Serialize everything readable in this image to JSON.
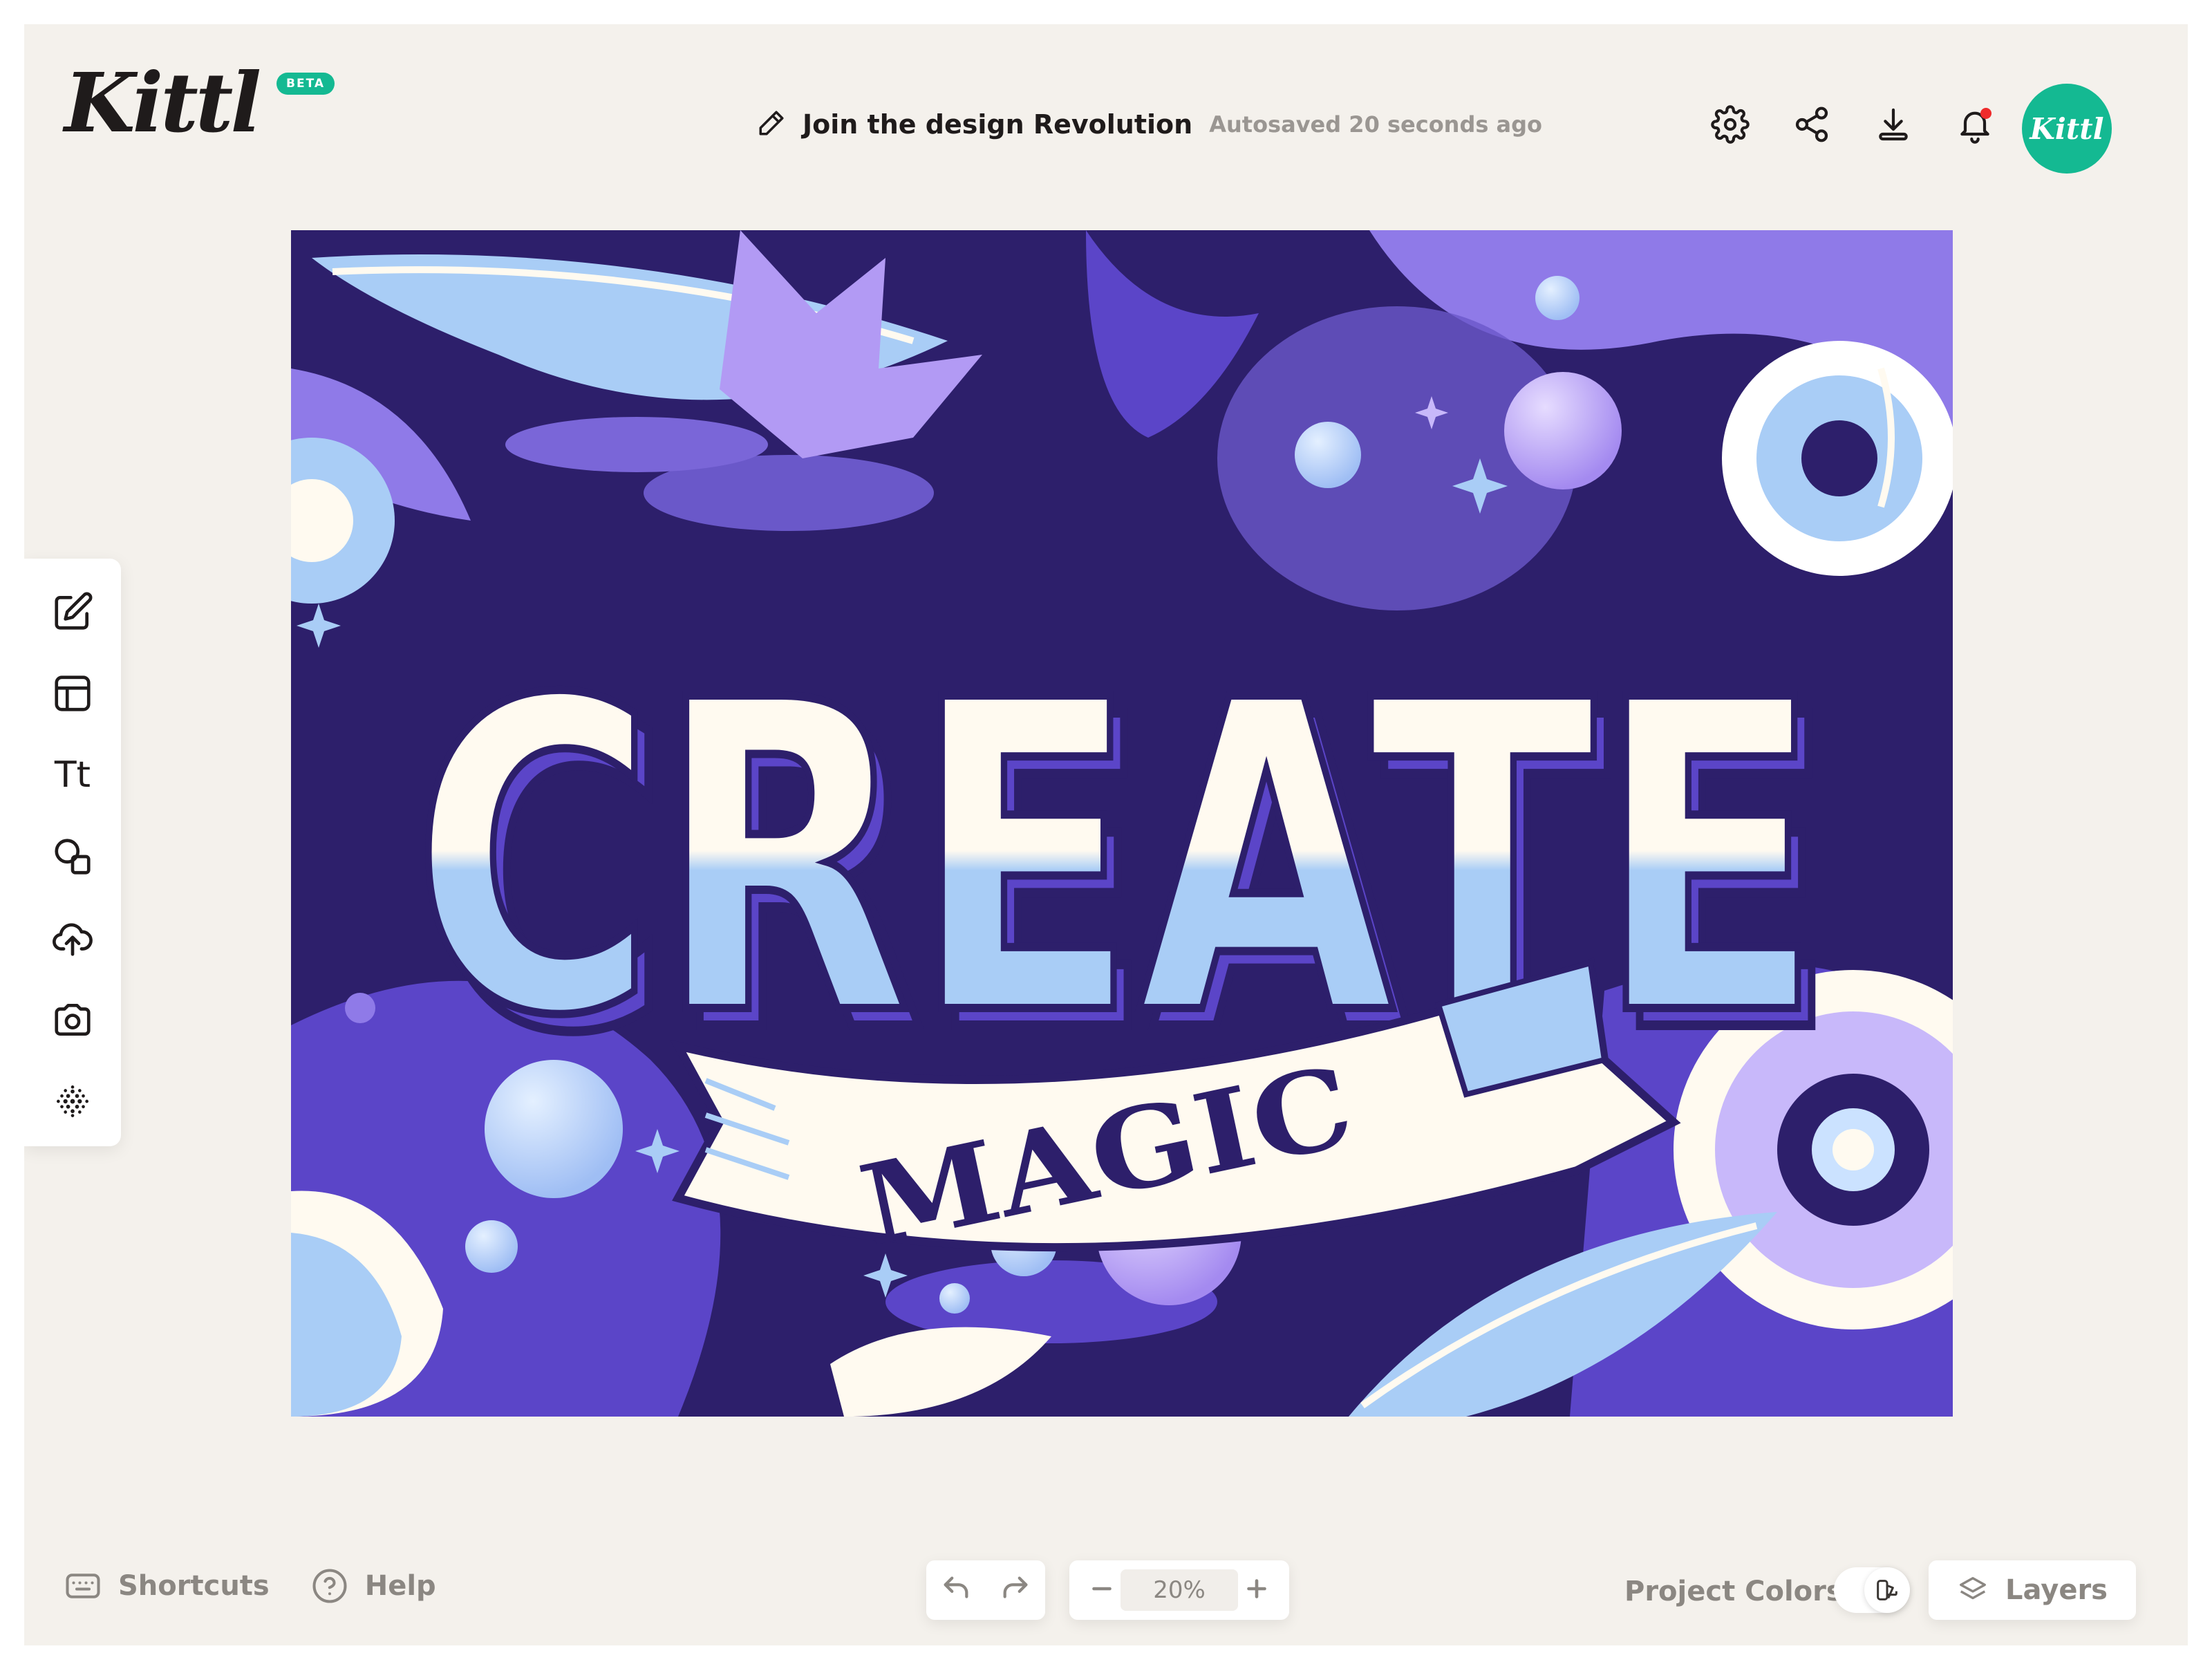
{
  "header": {
    "logo_text": "Kittl",
    "badge": "BETA",
    "project_title": "Join the design Revolution",
    "autosave_status": "Autosaved 20 seconds ago",
    "avatar_text": "Kittl",
    "icons": [
      "gear-icon",
      "share-icon",
      "download-icon",
      "bell-icon"
    ]
  },
  "toolbar": {
    "items": [
      {
        "name": "edit",
        "icon": "edit-icon"
      },
      {
        "name": "templates",
        "icon": "layout-icon"
      },
      {
        "name": "text",
        "icon": "text-icon",
        "label": "Tt"
      },
      {
        "name": "elements",
        "icon": "shapes-icon"
      },
      {
        "name": "uploads",
        "icon": "upload-icon"
      },
      {
        "name": "photos",
        "icon": "camera-icon"
      },
      {
        "name": "more",
        "icon": "dots-grid-icon"
      }
    ]
  },
  "canvas": {
    "headline": "CREATE",
    "banner_text": "MAGIC"
  },
  "footer": {
    "shortcuts_label": "Shortcuts",
    "help_label": "Help",
    "zoom_value": "20%",
    "project_colors_label": "Project Colors",
    "layers_label": "Layers"
  },
  "colors": {
    "app_background": "#f4f1ec",
    "brand_green": "#14b992",
    "notification": "#ef2b2b",
    "canvas_dark": "#2d1f6b",
    "canvas_purple": "#8f7ae8",
    "canvas_light_blue": "#a9cdf6",
    "canvas_cream": "#fffaf0"
  }
}
